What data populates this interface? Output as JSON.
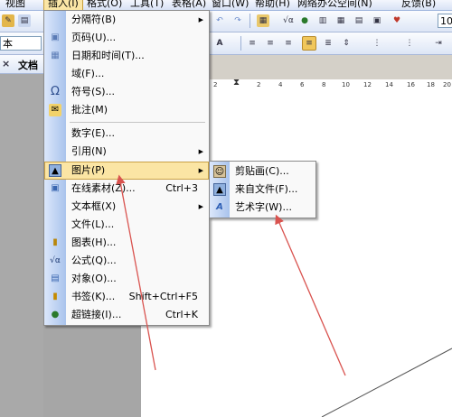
{
  "menubar": {
    "items": [
      "视图",
      "插入(I)",
      "格式(O)",
      "工具(T)",
      "表格(A)",
      "窗口(W)",
      "帮助(H)",
      "网络办公空间(N)",
      "反馈(B)"
    ]
  },
  "toolbar": {
    "style_box": "本",
    "font_size": "10",
    "doc_tab": "文档"
  },
  "insert_menu": {
    "items": [
      {
        "label": "分隔符(B)",
        "shortcut": "",
        "submenu": true,
        "icon": "page-break-icon"
      },
      {
        "label": "页码(U)...",
        "shortcut": "",
        "submenu": false,
        "icon": "page-number-icon"
      },
      {
        "label": "日期和时间(T)...",
        "shortcut": "",
        "submenu": false,
        "icon": "calendar-icon"
      },
      {
        "label": "域(F)...",
        "shortcut": "",
        "submenu": false,
        "icon": ""
      },
      {
        "label": "符号(S)...",
        "shortcut": "",
        "submenu": false,
        "icon": "omega-icon"
      },
      {
        "label": "批注(M)",
        "shortcut": "",
        "submenu": false,
        "icon": "comment-icon"
      },
      {
        "label": "数字(E)...",
        "shortcut": "",
        "submenu": false,
        "icon": ""
      },
      {
        "label": "引用(N)",
        "shortcut": "",
        "submenu": true,
        "icon": ""
      },
      {
        "label": "图片(P)",
        "shortcut": "",
        "submenu": true,
        "icon": "picture-icon",
        "highlight": true
      },
      {
        "label": "在线素材(Z)...",
        "shortcut": "Ctrl+3",
        "submenu": false,
        "icon": "online-material-icon"
      },
      {
        "label": "文本框(X)",
        "shortcut": "",
        "submenu": true,
        "icon": ""
      },
      {
        "label": "文件(L)...",
        "shortcut": "",
        "submenu": false,
        "icon": ""
      },
      {
        "label": "图表(H)...",
        "shortcut": "",
        "submenu": false,
        "icon": "chart-icon"
      },
      {
        "label": "公式(Q)...",
        "shortcut": "",
        "submenu": false,
        "icon": "formula-icon"
      },
      {
        "label": "对象(O)...",
        "shortcut": "",
        "submenu": false,
        "icon": "object-icon"
      },
      {
        "label": "书签(K)...",
        "shortcut": "Shift+Ctrl+F5",
        "submenu": false,
        "icon": "bookmark-icon"
      },
      {
        "label": "超链接(I)...",
        "shortcut": "Ctrl+K",
        "submenu": false,
        "icon": "hyperlink-icon"
      }
    ]
  },
  "picture_submenu": {
    "items": [
      {
        "label": "剪贴画(C)...",
        "icon": "clipart-icon"
      },
      {
        "label": "来自文件(F)...",
        "icon": "image-file-icon"
      },
      {
        "label": "艺术字(W)...",
        "icon": "wordart-icon"
      }
    ]
  },
  "ruler": {
    "ticks": [
      "2",
      "2",
      "4",
      "6",
      "8",
      "10",
      "12",
      "14",
      "16",
      "18",
      "20",
      "22"
    ]
  },
  "colors": {
    "highlight": "#fbe5a4",
    "annotation_arrow": "#d9534f"
  }
}
